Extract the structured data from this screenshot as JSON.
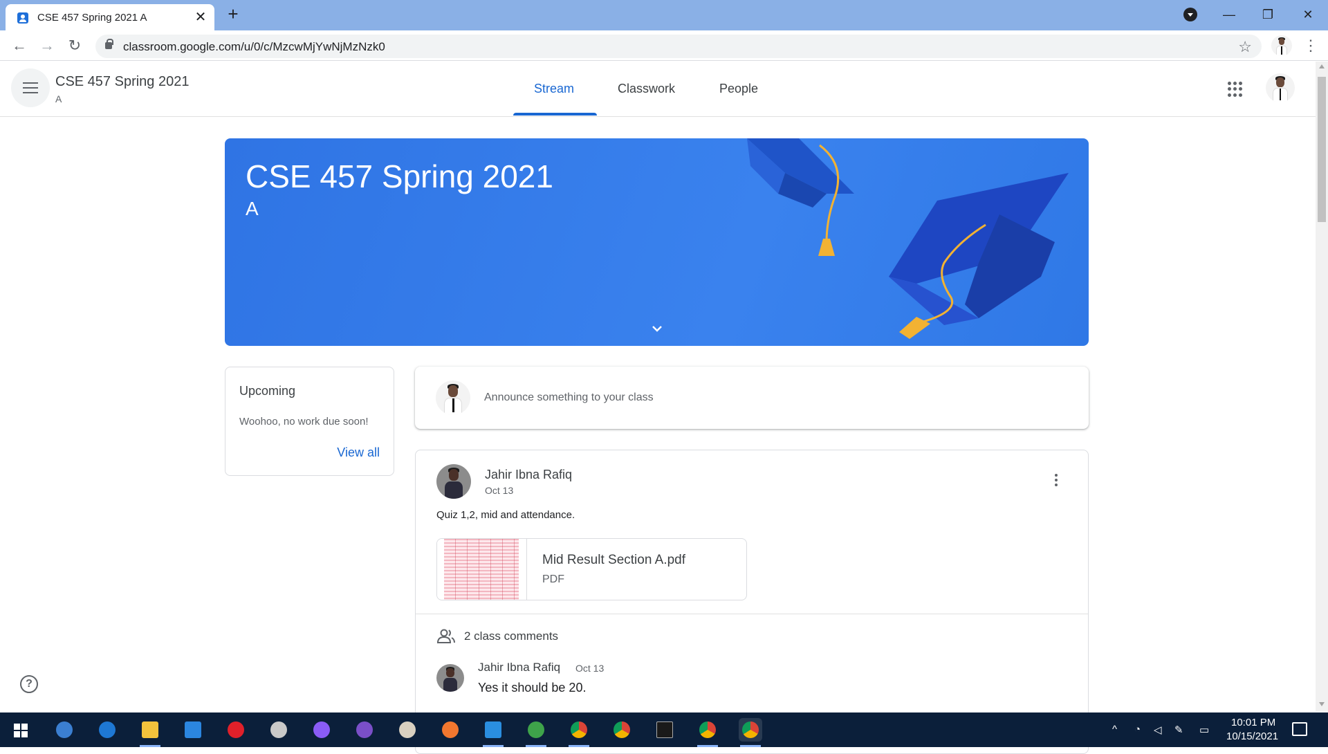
{
  "browser": {
    "tab_title": "CSE 457 Spring 2021 A",
    "tab_close": "✕",
    "new_tab": "+",
    "url": "classroom.google.com/u/0/c/MzcwMjYwNjMzNzk0",
    "back": "←",
    "forward": "→",
    "reload": "↻",
    "star": "☆",
    "menu": "⋮",
    "minimize": "—",
    "restore": "❐",
    "close": "✕"
  },
  "header": {
    "class_name": "CSE 457 Spring 2021",
    "section": "A",
    "tabs": [
      {
        "label": "Stream",
        "active": true
      },
      {
        "label": "Classwork",
        "active": false
      },
      {
        "label": "People",
        "active": false
      }
    ]
  },
  "banner": {
    "title": "CSE 457 Spring 2021",
    "section": "A",
    "color": "#3a82ee"
  },
  "upcoming": {
    "title": "Upcoming",
    "text": "Woohoo, no work due soon!",
    "link": "View all"
  },
  "announce": {
    "placeholder": "Announce something to your class"
  },
  "post": {
    "author": "Jahir Ibna Rafiq",
    "date": "Oct 13",
    "body": "Quiz 1,2, mid and attendance.",
    "attachment": {
      "name": "Mid Result Section A.pdf",
      "type": "PDF"
    },
    "comments_count": "2 class comments",
    "comment": {
      "author": "Jahir Ibna Rafiq",
      "date": "Oct 13",
      "text": "Yes it should be 20."
    }
  },
  "help": "?",
  "taskbar": {
    "apps": [
      "start",
      "qbittorrent-icon",
      "edge-icon",
      "file-explorer-icon",
      "mail-icon",
      "opera-icon",
      "satellite-icon",
      "messenger-icon",
      "github-icon",
      "paint-icon",
      "firefox-icon",
      "vscode-icon",
      "earth-icon",
      "chrome-icon",
      "chrome-icon",
      "terminal-icon",
      "chrome-ek-icon",
      "chrome-profile-icon"
    ],
    "time": "10:01 PM",
    "date": "10/15/2021"
  },
  "colors": {
    "accent": "#1967d2",
    "tabbar": "#8ab0e6",
    "taskbar": "#0b1f3a"
  }
}
